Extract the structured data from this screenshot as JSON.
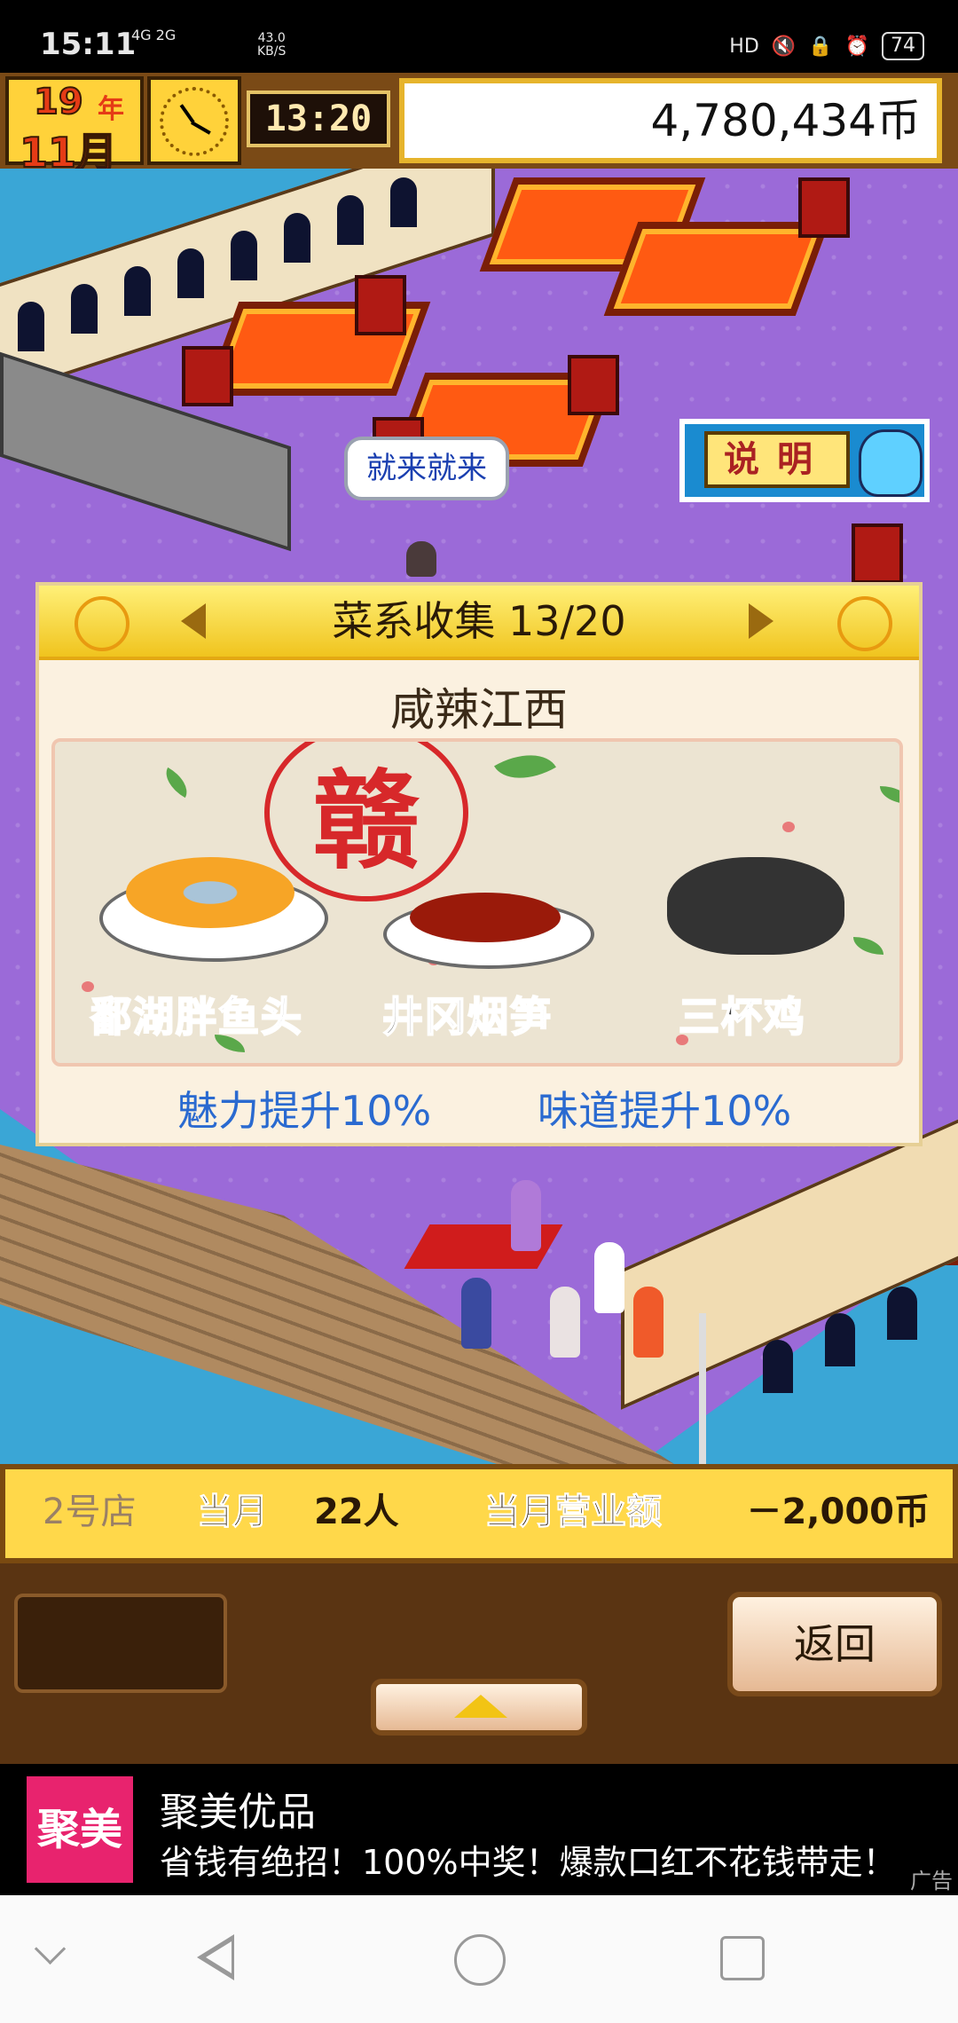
{
  "status_bar": {
    "time": "15:11",
    "network": "4G 2G",
    "speed_value": "43.0",
    "speed_unit": "KB/S",
    "hd": "HD",
    "battery": "74"
  },
  "hud": {
    "year_num": "19",
    "year_char": "年",
    "month": "11月",
    "clock_time": "13:20",
    "money": "4,780,434币"
  },
  "scene": {
    "speech_bubble": "就来就来",
    "help_label": "说明"
  },
  "dialog": {
    "title": "菜系收集 13/20",
    "cuisine_name": "咸辣江西",
    "stamp_char": "赣",
    "dishes": [
      {
        "name": "鄱湖胖鱼头"
      },
      {
        "name": "井冈烟笋"
      },
      {
        "name": "三杯鸡"
      }
    ],
    "bonus_left": "魅力提升10%",
    "bonus_right": "味道提升10%"
  },
  "store_bar": {
    "store": "2号店",
    "month_label": "当月",
    "customers": "22人",
    "revenue_label": "当月营业额",
    "revenue": "－2,000币"
  },
  "controls": {
    "back_label": "返回"
  },
  "ad": {
    "logo_text": "聚美",
    "title": "聚美优品",
    "description": "省钱有绝招！100%中奖！爆款口红不花钱带走！",
    "tag": "广告"
  },
  "colors": {
    "accent_gold": "#f0c41e",
    "bonus_blue": "#2a6ad0",
    "stamp_red": "#d7282a",
    "ad_pink": "#e8236e"
  }
}
